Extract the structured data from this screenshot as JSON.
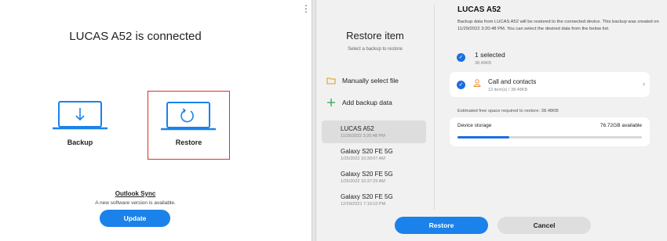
{
  "left_panel": {
    "menu_icon": "more-vertical-icon",
    "connection_title": "LUCAS A52 is connected",
    "backup_label": "Backup",
    "restore_label": "Restore",
    "outlook_title": "Outlook Sync",
    "outlook_message": "A new software version is available.",
    "update_label": "Update"
  },
  "restore_dialog": {
    "title": "Restore item",
    "subtitle": "Select a backup to restore",
    "manual_label": "Manually select file",
    "add_label": "Add backup data",
    "backups": [
      {
        "name": "LUCAS A52",
        "date": "11/29/2022 3:20:48 PM"
      },
      {
        "name": "Galaxy S20 FE 5G",
        "date": "1/25/2022 10:39:07 AM"
      },
      {
        "name": "Galaxy S20 FE 5G",
        "date": "1/25/2022 10:37:25 AM"
      },
      {
        "name": "Galaxy S20 FE 5G",
        "date": "12/29/2021 7:19:10 PM"
      }
    ],
    "device_name": "LUCAS A52",
    "description": "Backup data from LUCAS A52 will be restored to the connected device. This backup was created on 11/29/2022 3:20:48 PM. You can select the desired data from the below list.",
    "selected_title": "1 selected",
    "selected_size": "38.48KB",
    "contacts_title": "Call and contacts",
    "contacts_sub": "13 item(s) / 38.48KB",
    "free_space": "Estimated free space required to restore: 38.48KB",
    "storage_label": "Device storage",
    "storage_available": "76.72GB available",
    "storage_used_fraction": 0.28,
    "restore_button": "Restore",
    "cancel_button": "Cancel"
  },
  "colors": {
    "accent": "#1a82ea",
    "highlight_border": "#d93025"
  }
}
